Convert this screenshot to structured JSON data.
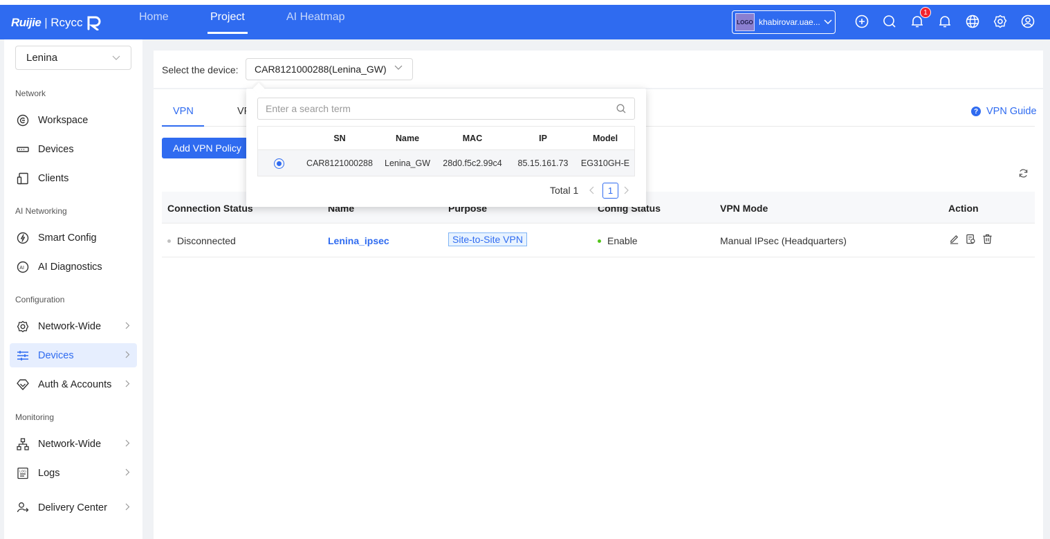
{
  "topbar": {
    "logo_brand": "Ruijie",
    "logo_sep": "|",
    "logo_product": "Rcycc",
    "nav": [
      {
        "label": "Home"
      },
      {
        "label": "Project"
      },
      {
        "label": "AI Heatmap"
      }
    ],
    "account": {
      "avatar_text": "LOGO",
      "name": "khabirovar.uae..."
    },
    "notification_count": "1",
    "icons": [
      "add-icon",
      "search-icon",
      "notification-icon",
      "bell-icon",
      "globe-icon",
      "settings-icon",
      "user-icon"
    ]
  },
  "sidebar": {
    "project": "Lenina",
    "groups": [
      {
        "title": "Network",
        "items": [
          {
            "label": "Workspace",
            "icon": "workspace-icon"
          },
          {
            "label": "Devices",
            "icon": "devices-icon"
          },
          {
            "label": "Clients",
            "icon": "clients-icon"
          }
        ]
      },
      {
        "title": "AI Networking",
        "items": [
          {
            "label": "Smart Config",
            "icon": "smart-config-icon"
          },
          {
            "label": "AI Diagnostics",
            "icon": "ai-diagnostics-icon"
          }
        ]
      },
      {
        "title": "Configuration",
        "items": [
          {
            "label": "Network-Wide",
            "icon": "gear-icon"
          },
          {
            "label": "Devices",
            "icon": "sliders-icon"
          },
          {
            "label": "Auth & Accounts",
            "icon": "diamond-icon"
          }
        ]
      },
      {
        "title": "Monitoring",
        "items": [
          {
            "label": "Network-Wide",
            "icon": "topology-icon"
          },
          {
            "label": "Logs",
            "icon": "logs-icon"
          },
          {
            "label": "Delivery Center",
            "icon": "delivery-icon"
          }
        ]
      }
    ]
  },
  "device_select": {
    "label": "Select the device:",
    "value": "CAR8121000288(Lenina_GW)"
  },
  "tabs": [
    {
      "label": "VPN"
    },
    {
      "label": "VF"
    }
  ],
  "vpn_guide": "VPN Guide",
  "add_button": "Add VPN Policy",
  "table": {
    "headers": [
      "Connection Status",
      "Name",
      "Purpose",
      "Config Status",
      "VPN Mode",
      "Action"
    ],
    "rows": [
      {
        "connection_status": "Disconnected",
        "name": "Lenina_ipsec",
        "purpose": "Site-to-Site VPN",
        "config_status": "Enable",
        "vpn_mode": "Manual IPsec (Headquarters)"
      }
    ]
  },
  "popup": {
    "search_placeholder": "Enter a search term",
    "headers": [
      "SN",
      "Name",
      "MAC",
      "IP",
      "Model"
    ],
    "rows": [
      {
        "sn": "CAR8121000288",
        "name": "Lenina_GW",
        "mac": "28d0.f5c2.99c4",
        "ip": "85.15.161.73",
        "model": "EG310GH-E"
      }
    ],
    "total": "Total 1",
    "page": "1"
  },
  "colors": {
    "primary": "#2f6bf0",
    "success": "#52c41a",
    "disconnected": "#c0c0c0",
    "badge": "#f5222d"
  }
}
